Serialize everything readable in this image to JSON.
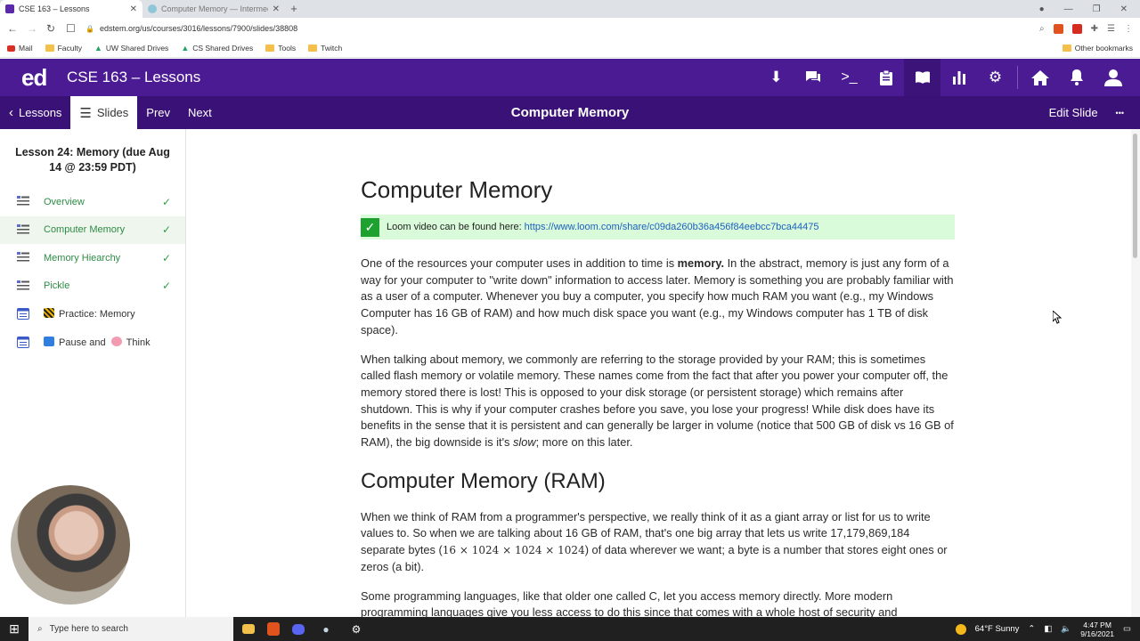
{
  "browser": {
    "tabs": [
      {
        "title": "CSE 163 – Lessons",
        "active": true
      },
      {
        "title": "Computer Memory — Intermediate D",
        "active": false
      }
    ],
    "new_tab": "+",
    "url": "edstem.org/us/courses/3016/lessons/7900/slides/38808",
    "bookmarks": [
      "Mail",
      "Faculty",
      "UW Shared Drives",
      "CS Shared Drives",
      "Tools",
      "Twitch"
    ],
    "other_bookmarks": "Other bookmarks"
  },
  "app": {
    "logo": "ed",
    "course_title": "CSE 163 – Lessons",
    "toolbar_icons": [
      "download-icon",
      "chat-icon",
      "terminal-icon",
      "clipboard-icon",
      "lessons-icon",
      "analytics-icon",
      "settings-icon",
      "home-icon",
      "bell-icon",
      "user-icon"
    ]
  },
  "subbar": {
    "lessons_label": "Lessons",
    "slides_label": "Slides",
    "prev_label": "Prev",
    "next_label": "Next",
    "slide_title": "Computer Memory",
    "edit_label": "Edit Slide",
    "more_label": "•••"
  },
  "sidebar": {
    "lesson_title": "Lesson 24: Memory (due Aug 14 @ 23:59 PDT)",
    "items": [
      {
        "label": "Overview",
        "done": true
      },
      {
        "label": "Computer Memory",
        "done": true,
        "current": true
      },
      {
        "label": "Memory Hiearchy",
        "done": true
      },
      {
        "label": "Pickle",
        "done": true
      },
      {
        "label": "Practice: Memory",
        "done": false
      },
      {
        "label": "Pause and",
        "label2": "Think",
        "done": false
      }
    ],
    "check": "✓"
  },
  "content": {
    "h1": "Computer Memory",
    "loom_text": "Loom video can be found here:",
    "loom_link": "https://www.loom.com/share/c09da260b36a456f84eebcc7bca44475",
    "p1_a": "One of the resources your computer uses in addition to time is ",
    "p1_bold": "memory.",
    "p1_b": " In the abstract, memory is just any form of a way for your computer to \"write down\" information to access later. Memory is something you are probably familiar with as a user of a computer. Whenever you buy a computer, you specify how much RAM you want (e.g., my Windows Computer has 16 GB of RAM) and how much disk space you want (e.g., my Windows computer has 1 TB of disk space).",
    "p2_a": "When talking about memory, we commonly are referring to the storage provided by your RAM; this is sometimes called flash memory or volatile memory. These names come from the fact that after you power your computer off, the memory stored there is lost! This is opposed to your disk storage (or persistent storage) which remains after shutdown. This is why if your computer crashes before you save, you lose your progress! While disk does have its benefits in the sense that it is persistent and can generally be larger in volume (notice that 500 GB of disk vs 16 GB of RAM), the big downside is it's ",
    "p2_em": "slow",
    "p2_b": "; more on this later.",
    "h2": "Computer Memory (RAM)",
    "p3_a": "When we think of RAM from a programmer's perspective, we really think of it as a giant array or list for us to write values to. So when we are talking about 16 GB of RAM, that's one big array that lets us write 17,179,869,184 separate bytes (",
    "p3_math": "16 × 1024 × 1024 × 1024",
    "p3_b": ") of data wherever we want;  a byte is a number that stores eight ones or zeros (a bit).",
    "p4": "Some programming languages, like that older one called C, let you access memory directly. More modern programming languages give you less access to do this since that comes with a whole host of security and"
  },
  "taskbar": {
    "search_placeholder": "Type here to search",
    "weather": "64°F  Sunny",
    "time": "4:47 PM",
    "date": "9/16/2021"
  },
  "colors": {
    "ed_purple": "#4b1b93",
    "ed_purple_dark": "#3a1176",
    "done_green": "#2e8b45",
    "loom_bg": "#d9fbd9"
  }
}
